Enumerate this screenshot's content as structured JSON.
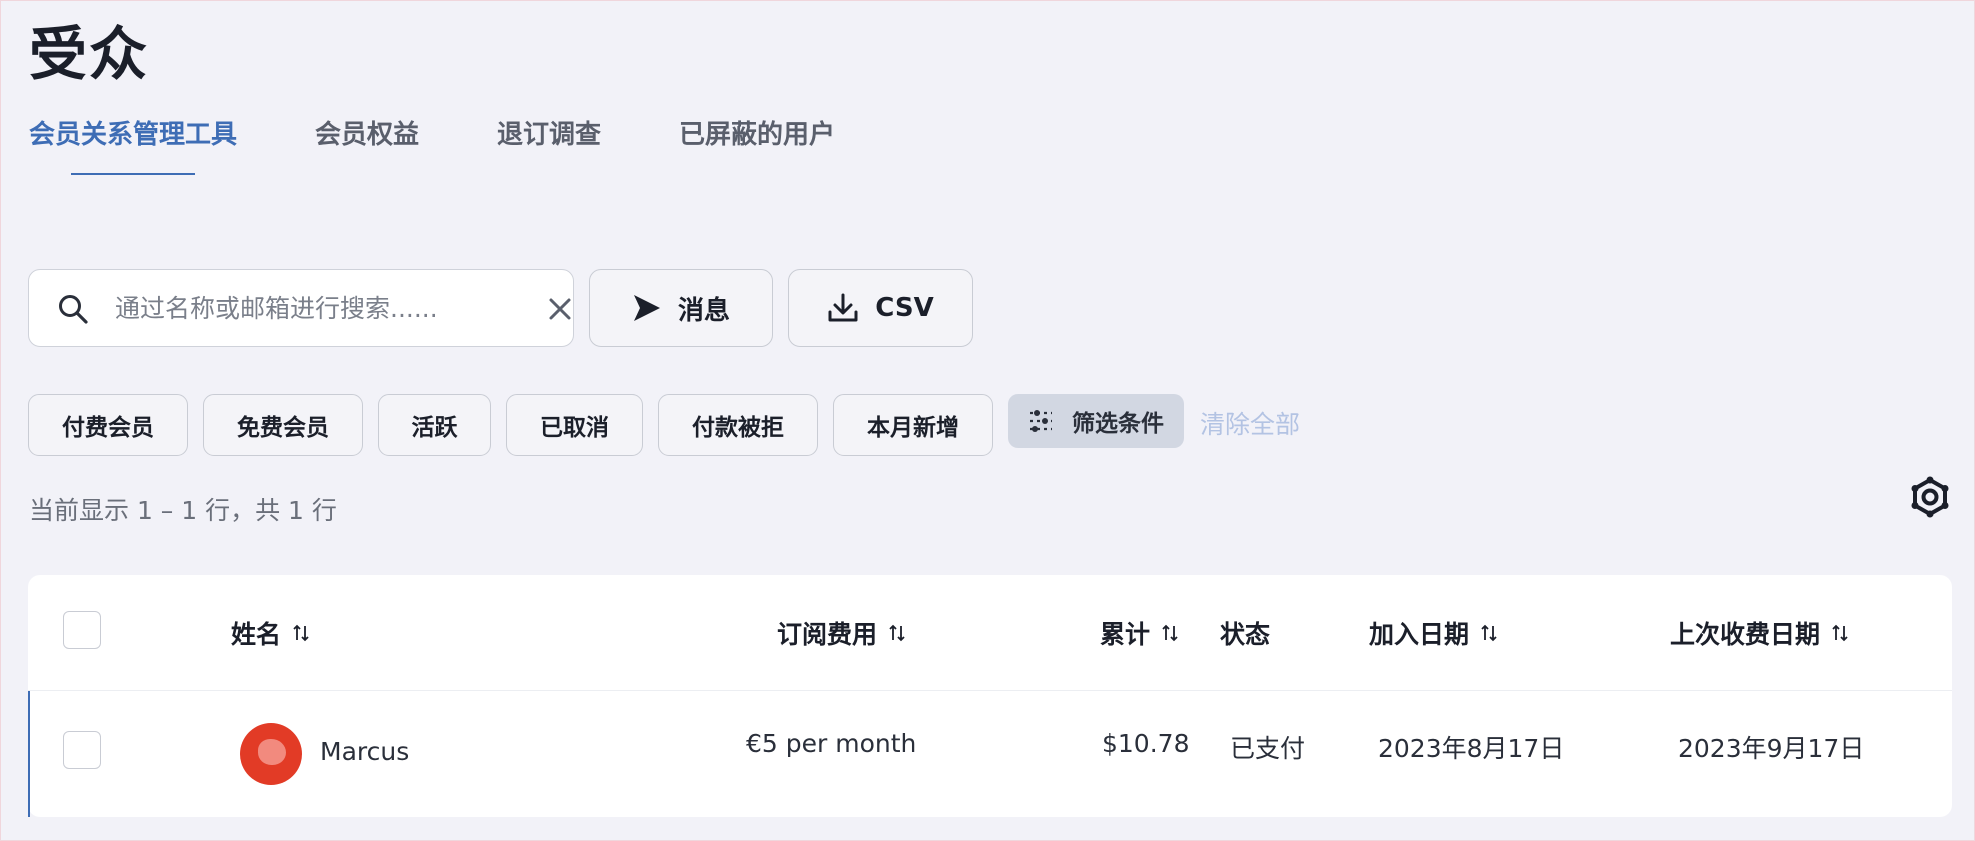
{
  "page": {
    "title": "受众"
  },
  "tabs": [
    {
      "label": "会员关系管理工具",
      "active": true
    },
    {
      "label": "会员权益",
      "active": false
    },
    {
      "label": "退订调查",
      "active": false
    },
    {
      "label": "已屏蔽的用户",
      "active": false
    }
  ],
  "toolbar": {
    "search_placeholder": "通过名称或邮箱进行搜索......",
    "search_value": "",
    "message_label": "消息",
    "csv_label": "CSV"
  },
  "filters": {
    "chips": [
      "付费会员",
      "免费会员",
      "活跃",
      "已取消",
      "付款被拒",
      "本月新增"
    ],
    "filter_label": "筛选条件",
    "clear_all_label": "清除全部"
  },
  "summary": {
    "row_count_text": "当前显示 1 – 1 行，共 1 行"
  },
  "table": {
    "columns": [
      "姓名",
      "订阅费用",
      "累计",
      "状态",
      "加入日期",
      "上次收费日期"
    ],
    "rows": [
      {
        "name": "Marcus",
        "subscription": "€5 per month",
        "lifetime": "$10.78",
        "status": "已支付",
        "joined": "2023年8月17日",
        "last_charge": "2023年9月17日"
      }
    ]
  },
  "colors": {
    "accent": "#3e6db5",
    "background": "#f2f2f8",
    "avatar": "#e23b26",
    "clear_all": "#b3c3e3"
  },
  "icons": [
    "search-icon",
    "clear-icon",
    "send-icon",
    "download-icon",
    "filter-sliders-icon",
    "settings-gear-icon",
    "sort-icon"
  ]
}
